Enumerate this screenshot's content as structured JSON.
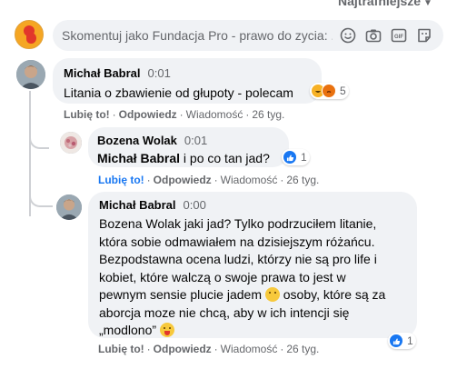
{
  "sort": {
    "label": "Najtrafniejsze"
  },
  "composer": {
    "placeholder": "Skomentuj jako Fundacja Pro - prawo do zycia: ..."
  },
  "comments": [
    {
      "author": "Michał Babral",
      "time": "0:01",
      "text": "Litania o zbawienie od głupoty - polecam",
      "reaction_count": "5",
      "actions": {
        "like": "Lubię to!",
        "reply": "Odpowiedz",
        "message": "Wiadomość",
        "age": "26 tyg."
      }
    },
    {
      "author": "Bozena Wolak",
      "time": "0:01",
      "mention": "Michał Babral",
      "text": " i po co tan jad?",
      "reaction_count": "1",
      "actions": {
        "like": "Lubię to!",
        "reply": "Odpowiedz",
        "message": "Wiadomość",
        "age": "26 tyg."
      }
    },
    {
      "author": "Michał Babral",
      "time": "0:00",
      "text_lines": [
        "Bozena Wolak jaki jad? Tylko podrzuciłem litanie,",
        "która sobie odmawiałem na dzisiejszym różańcu.",
        "Bezpodstawna ocena ludzi, którzy nie są pro life i",
        "kobiet, które walczą o swoje prawa to jest w",
        "pewnym sensie plucie jadem",
        " osoby, które są za",
        "aborcja moze nie chcą, aby w ich intencji się",
        "„modlono”"
      ],
      "reaction_count": "1",
      "actions": {
        "like": "Lubię to!",
        "reply": "Odpowiedz",
        "message": "Wiadomość",
        "age": "26 tyg."
      }
    }
  ],
  "icons": {
    "emoji": "smiley-icon",
    "camera": "camera-icon",
    "gif": "gif-icon",
    "sticker": "sticker-icon"
  },
  "colors": {
    "like": "#1877f2",
    "bubble": "#f0f2f5",
    "muted": "#65676b"
  }
}
